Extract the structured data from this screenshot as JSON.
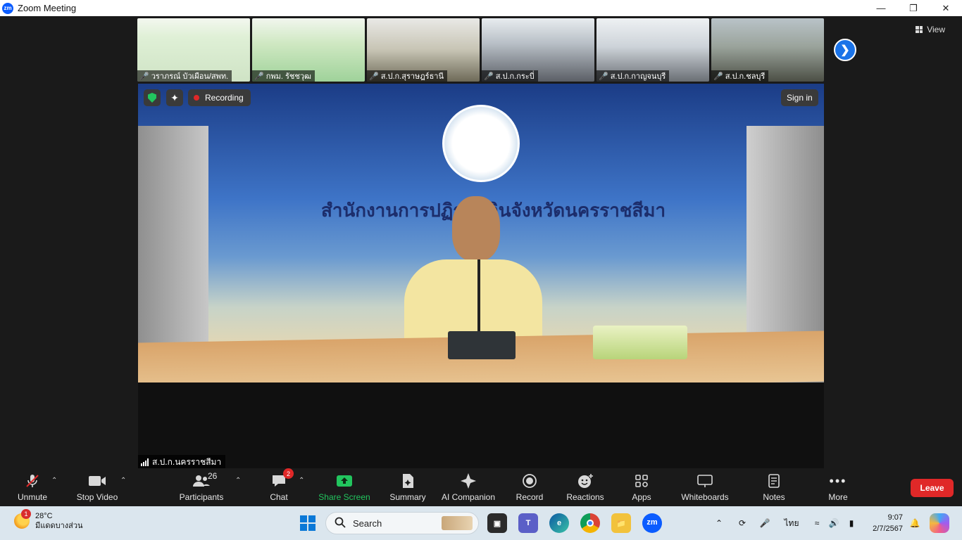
{
  "window": {
    "app_title": "Zoom Meeting",
    "logo_text": "zm"
  },
  "view_button": {
    "label": "View"
  },
  "thumbnails": [
    {
      "name": "วราภรณ์ บัวเผือน/สพท."
    },
    {
      "name": "กพม. รัชชวุฒ"
    },
    {
      "name": "ส.ป.ก.สุราษฎร์ธานี"
    },
    {
      "name": "ส.ป.ก.กระบี่"
    },
    {
      "name": "ส.ป.ก.กาญจนบุรี"
    },
    {
      "name": "ส.ป.ก.ชลบุรี"
    }
  ],
  "main_video": {
    "banner_title": "สำนักงานการปฏิรูปที่ดินจังหวัดนครราชสีมา",
    "recording_label": "Recording",
    "signin_label": "Sign in",
    "speaker_name": "ส.ป.ก.นครราชสีมา"
  },
  "toolbar": {
    "unmute": "Unmute",
    "stop_video": "Stop Video",
    "participants": "Participants",
    "participants_count": "26",
    "chat": "Chat",
    "chat_badge": "2",
    "share_screen": "Share Screen",
    "summary": "Summary",
    "ai_companion": "AI Companion",
    "record": "Record",
    "reactions": "Reactions",
    "apps": "Apps",
    "whiteboards": "Whiteboards",
    "notes": "Notes",
    "more": "More",
    "leave": "Leave"
  },
  "taskbar": {
    "weather_badge": "1",
    "temperature": "28°C",
    "weather_desc": "มีแดดบางส่วน",
    "search_placeholder": "Search",
    "language": "ไทย",
    "time": "9:07",
    "date": "2/7/2567"
  },
  "colors": {
    "accent": "#0b5cff",
    "share_green": "#22c55e",
    "leave_red": "#e02828"
  }
}
